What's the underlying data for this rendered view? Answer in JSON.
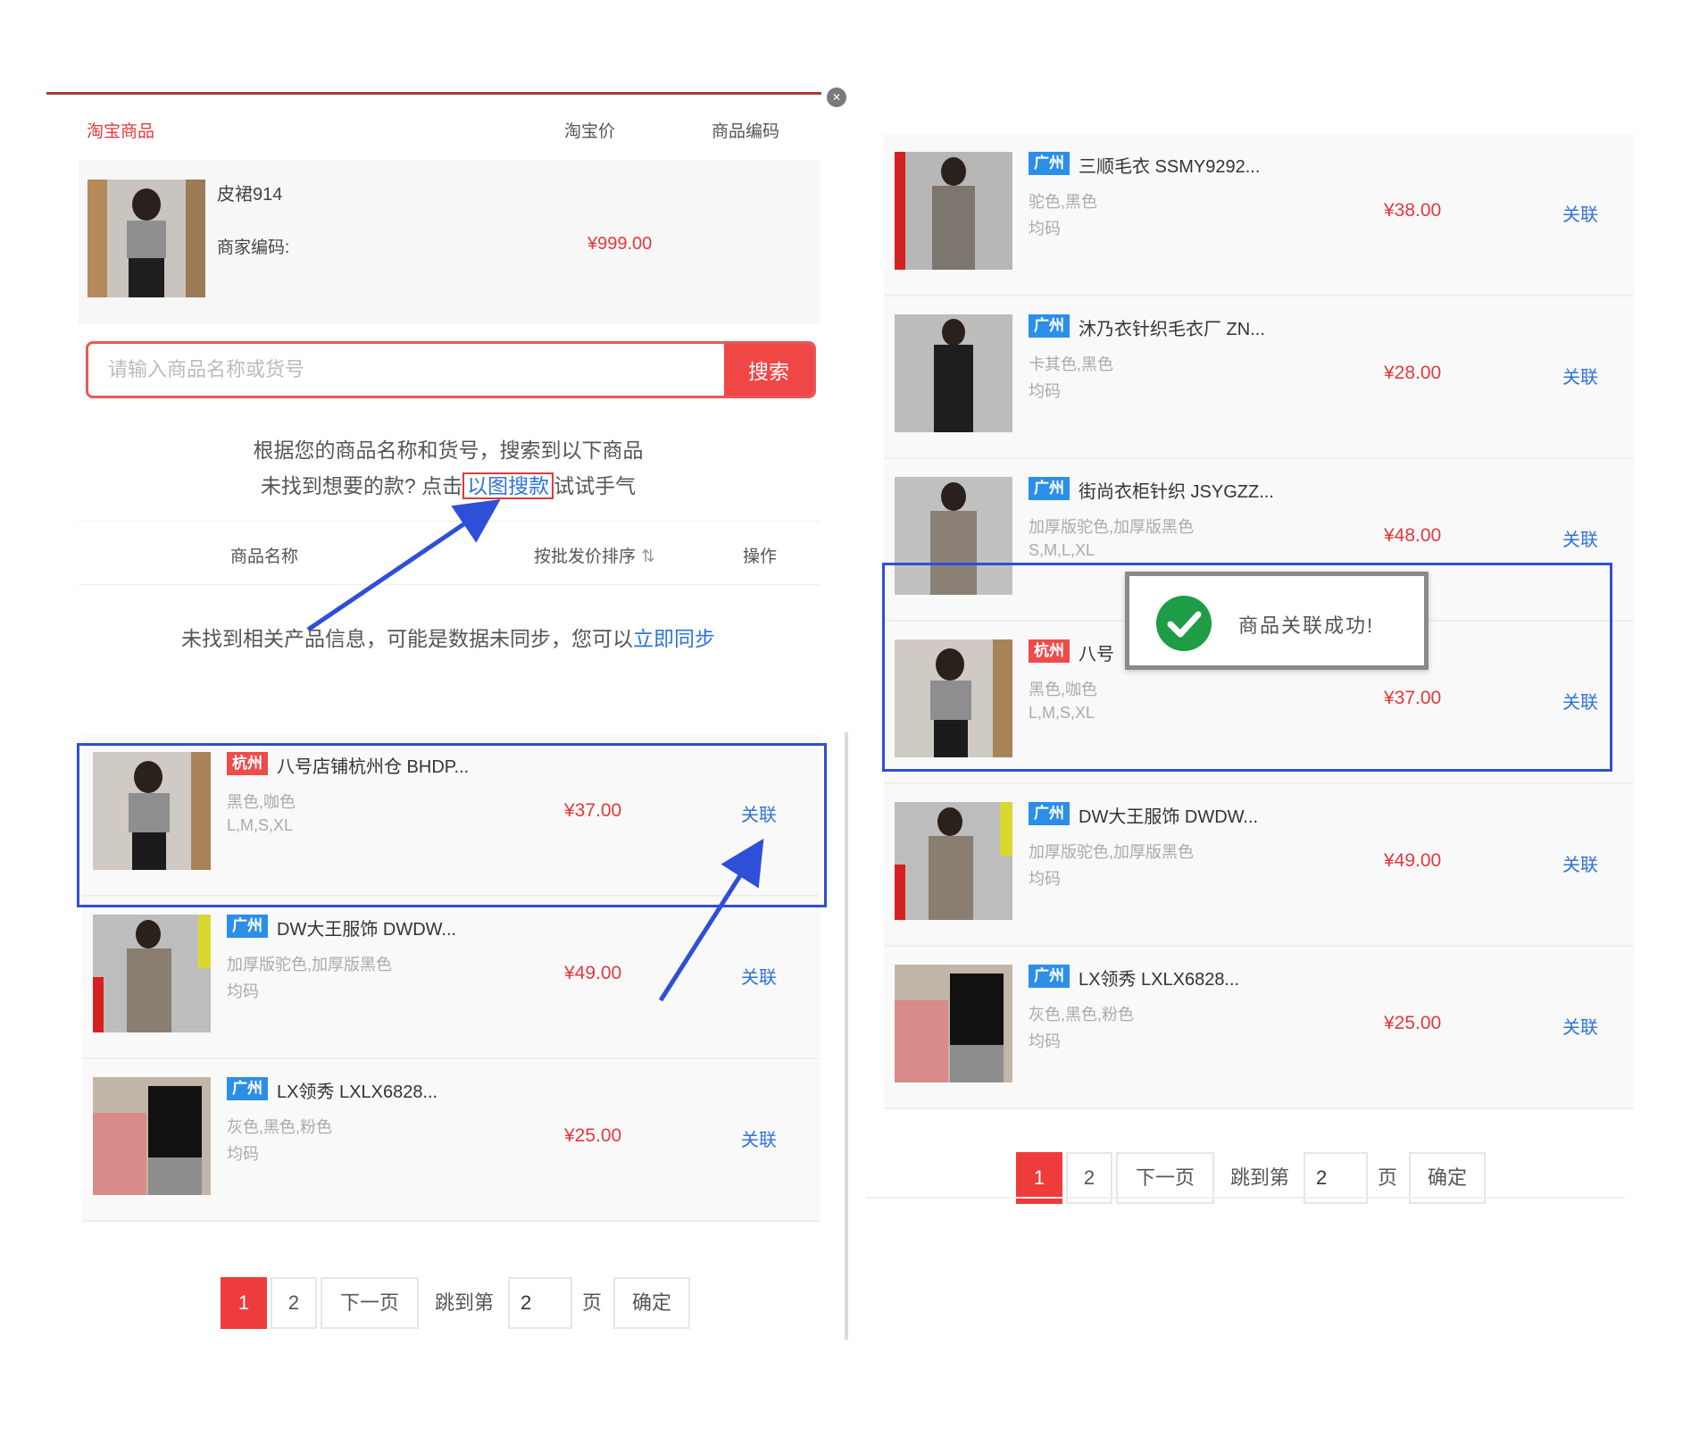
{
  "left": {
    "header": {
      "col_taobao": "淘宝商品",
      "col_price": "淘宝价",
      "col_code": "商品编码"
    },
    "source": {
      "name": "皮裙914",
      "code_label": "商家编码:",
      "price": "¥999.00"
    },
    "search": {
      "placeholder": "请输入商品名称或货号",
      "button": "搜索"
    },
    "result": {
      "line1": "根据您的商品名称和货号，搜索到以下商品",
      "line2_prefix": "未找到想要的款? 点击",
      "line2_link": "以图搜款",
      "line2_suffix": "试试手气"
    },
    "list_header": {
      "name": "商品名称",
      "sort": "按批发价排序",
      "op": "操作"
    },
    "sync": {
      "prefix": "未找到相关产品信息，可能是数据未同步，您可以",
      "link": "立即同步"
    },
    "products": [
      {
        "tag": "杭州",
        "title": "八号店铺杭州仓 BHDP...",
        "colors": "黑色,咖色",
        "sizes": "L,M,S,XL",
        "price": "¥37.00",
        "action": "关联"
      },
      {
        "tag": "广州",
        "title": "DW大王服饰 DWDW...",
        "colors": "加厚版驼色,加厚版黑色",
        "sizes": "均码",
        "price": "¥49.00",
        "action": "关联"
      },
      {
        "tag": "广州",
        "title": "LX领秀 LXLX6828...",
        "colors": "灰色,黑色,粉色",
        "sizes": "均码",
        "price": "¥25.00",
        "action": "关联"
      }
    ],
    "pager": {
      "page1": "1",
      "page2": "2",
      "next": "下一页",
      "jump_prefix": "跳到第",
      "jump_value": "2",
      "jump_suffix": "页",
      "confirm": "确定"
    }
  },
  "right": {
    "products": [
      {
        "tag": "广州",
        "title": "三顺毛衣 SSMY9292...",
        "colors": "驼色,黑色",
        "sizes": "均码",
        "price": "¥38.00",
        "action": "关联"
      },
      {
        "tag": "广州",
        "title": "沐乃衣针织毛衣厂 ZN...",
        "colors": "卡其色,黑色",
        "sizes": "均码",
        "price": "¥28.00",
        "action": "关联"
      },
      {
        "tag": "广州",
        "title": "街尚衣柜针织 JSYGZZ...",
        "colors": "加厚版驼色,加厚版黑色",
        "sizes": "S,M,L,XL",
        "price": "¥48.00",
        "action": "关联"
      },
      {
        "tag": "杭州",
        "title": "八号",
        "colors": "黑色,咖色",
        "sizes": "L,M,S,XL",
        "price": "¥37.00",
        "action": "关联"
      },
      {
        "tag": "广州",
        "title": "DW大王服饰 DWDW...",
        "colors": "加厚版驼色,加厚版黑色",
        "sizes": "均码",
        "price": "¥49.00",
        "action": "关联"
      },
      {
        "tag": "广州",
        "title": "LX领秀 LXLX6828...",
        "colors": "灰色,黑色,粉色",
        "sizes": "均码",
        "price": "¥25.00",
        "action": "关联"
      }
    ],
    "toast": "商品关联成功!",
    "pager": {
      "page1": "1",
      "page2": "2",
      "next": "下一页",
      "jump_prefix": "跳到第",
      "jump_value": "2",
      "jump_suffix": "页",
      "confirm": "确定"
    }
  },
  "colors": {
    "accent_red": "#ef3b3b",
    "link_blue": "#2f74d8",
    "highlight_blue": "#2e4fd8",
    "tag_hangzhou": "#ee4b4b",
    "tag_guangzhou": "#2b8fe8",
    "success_green": "#1f9d46"
  },
  "icons": [
    "close-icon",
    "sort-icon",
    "checkmark-icon",
    "arrow-annotation"
  ]
}
